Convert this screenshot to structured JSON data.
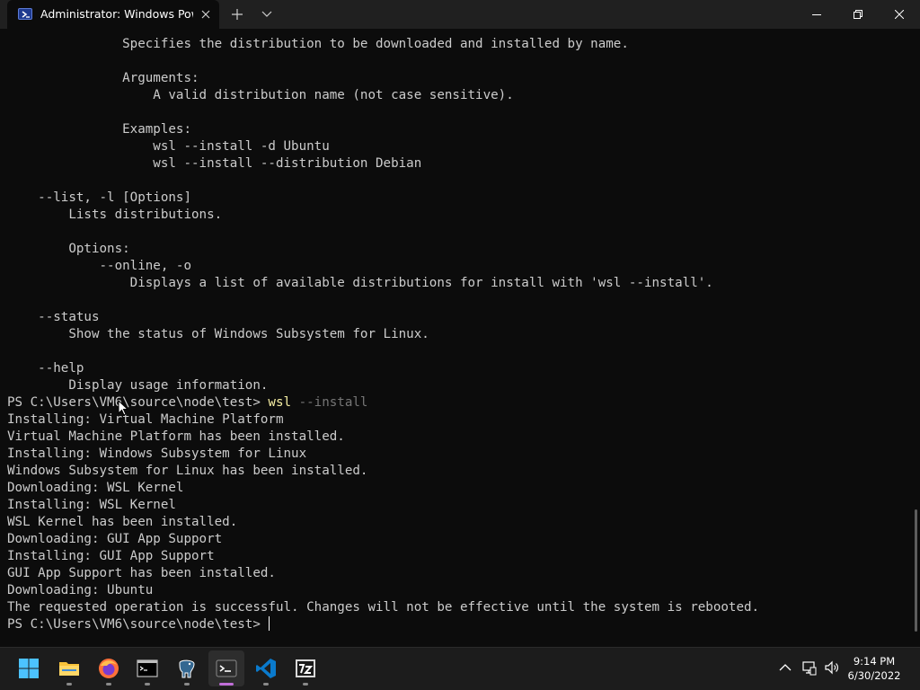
{
  "window": {
    "tab_title": "Administrator: Windows PowerShell",
    "tab_icon": "powershell-icon",
    "controls": [
      "minimize-icon",
      "maximize-icon",
      "close-icon"
    ]
  },
  "terminal": {
    "lines": [
      {
        "text": "               Specifies the distribution to be downloaded and installed by name."
      },
      {
        "text": ""
      },
      {
        "text": "               Arguments:"
      },
      {
        "text": "                   A valid distribution name (not case sensitive)."
      },
      {
        "text": ""
      },
      {
        "text": "               Examples:"
      },
      {
        "text": "                   wsl --install -d Ubuntu"
      },
      {
        "text": "                   wsl --install --distribution Debian"
      },
      {
        "text": ""
      },
      {
        "text": "    --list, -l [Options]"
      },
      {
        "text": "        Lists distributions."
      },
      {
        "text": ""
      },
      {
        "text": "        Options:"
      },
      {
        "text": "            --online, -o"
      },
      {
        "text": "                Displays a list of available distributions for install with 'wsl --install'."
      },
      {
        "text": ""
      },
      {
        "text": "    --status"
      },
      {
        "text": "        Show the status of Windows Subsystem for Linux."
      },
      {
        "text": ""
      },
      {
        "text": "    --help"
      },
      {
        "text": "        Display usage information."
      },
      {
        "prompt": "PS C:\\Users\\VM6\\source\\node\\test> ",
        "command": "wsl",
        "args": " --install"
      },
      {
        "text": "Installing: Virtual Machine Platform"
      },
      {
        "text": "Virtual Machine Platform has been installed."
      },
      {
        "text": "Installing: Windows Subsystem for Linux"
      },
      {
        "text": "Windows Subsystem for Linux has been installed."
      },
      {
        "text": "Downloading: WSL Kernel"
      },
      {
        "text": "Installing: WSL Kernel"
      },
      {
        "text": "WSL Kernel has been installed."
      },
      {
        "text": "Downloading: GUI App Support"
      },
      {
        "text": "Installing: GUI App Support"
      },
      {
        "text": "GUI App Support has been installed."
      },
      {
        "text": "Downloading: Ubuntu"
      },
      {
        "text": "The requested operation is successful. Changes will not be effective until the system is rebooted."
      },
      {
        "prompt": "PS C:\\Users\\VM6\\source\\node\\test> ",
        "cursor": true
      }
    ]
  },
  "taskbar": {
    "apps": [
      {
        "name": "start-button",
        "icon": "windows-logo-icon",
        "running": false
      },
      {
        "name": "file-explorer",
        "icon": "folder-icon",
        "running": true
      },
      {
        "name": "firefox",
        "icon": "firefox-icon",
        "running": true
      },
      {
        "name": "command-prompt",
        "icon": "cmd-icon",
        "running": true
      },
      {
        "name": "pgadmin",
        "icon": "elephant-icon",
        "running": true
      },
      {
        "name": "windows-terminal",
        "icon": "terminal-icon",
        "running": true,
        "active": true
      },
      {
        "name": "vscode",
        "icon": "vscode-icon",
        "running": true
      },
      {
        "name": "7zip",
        "icon": "7zip-icon",
        "running": true
      }
    ],
    "tray": [
      "chevron-up-icon",
      "network-icon",
      "volume-icon"
    ],
    "clock": {
      "time": "9:14 PM",
      "date": "6/30/2022"
    }
  },
  "colors": {
    "terminal_bg": "#0c0c0c",
    "terminal_fg": "#cccccc",
    "command": "#f9f1a5",
    "parameter": "#767676",
    "titlebar": "#202020",
    "taskbar": "#1c1c1c"
  }
}
